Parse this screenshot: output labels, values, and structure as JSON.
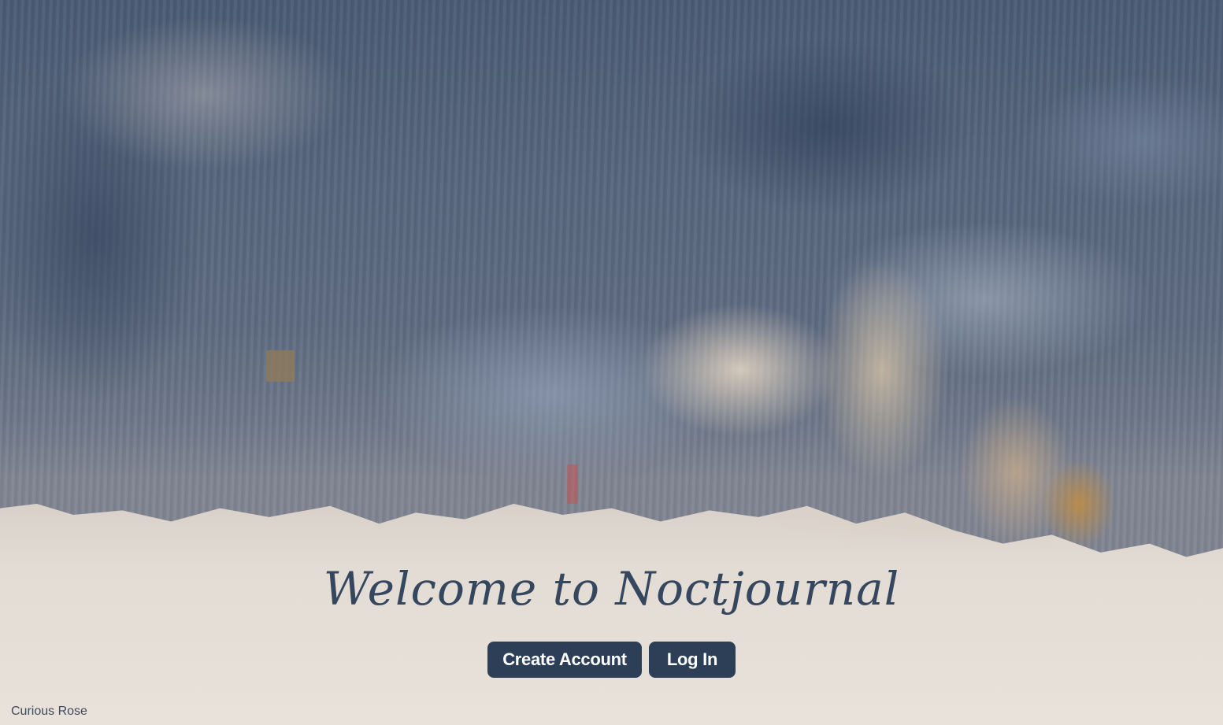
{
  "landing": {
    "title": "Welcome to Noctjournal",
    "buttons": {
      "create_account": "Create Account",
      "log_in": "Log In"
    }
  },
  "footer": {
    "credit": "Curious Rose"
  },
  "colors": {
    "heading": "#35465f",
    "button_bg": "#2d3f57",
    "button_text": "#ffffff",
    "wall_dark": "#4a5a73",
    "wall_light": "#e8e2db"
  }
}
